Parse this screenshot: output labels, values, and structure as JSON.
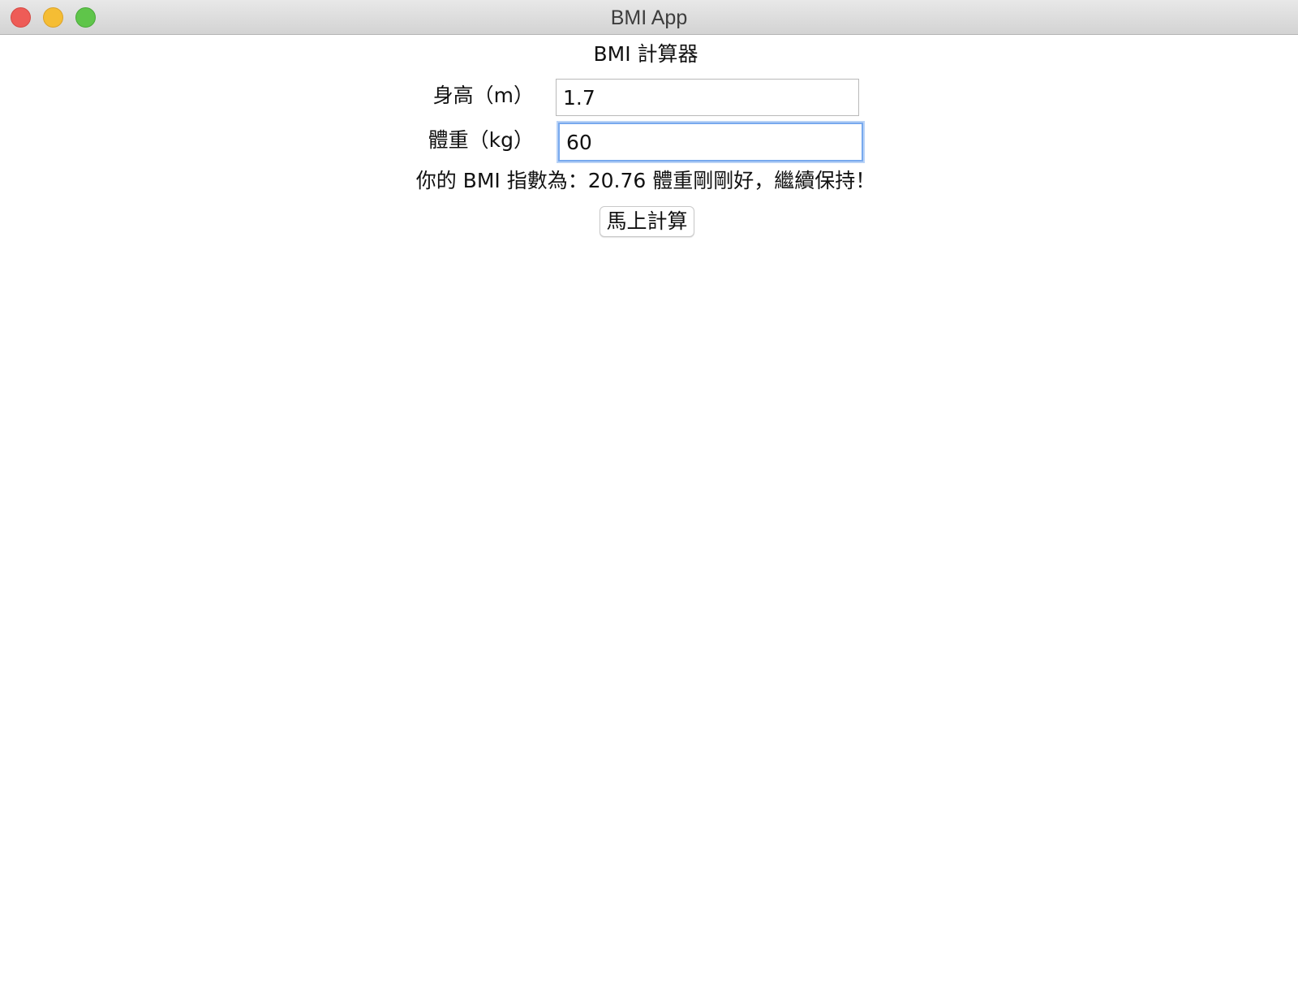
{
  "window": {
    "title": "BMI App"
  },
  "app": {
    "heading": "BMI 計算器",
    "height_label": "身高（m）",
    "height_value": "1.7",
    "weight_label": "體重（kg）",
    "weight_value": "60",
    "result": "你的 BMI 指數為：20.76 體重剛剛好，繼續保持！",
    "calculate_label": "馬上計算"
  },
  "colors": {
    "close": "#ee5c57",
    "minimize": "#f5bd34",
    "zoom": "#5fc54a",
    "focus_ring": "#78a9ee"
  }
}
